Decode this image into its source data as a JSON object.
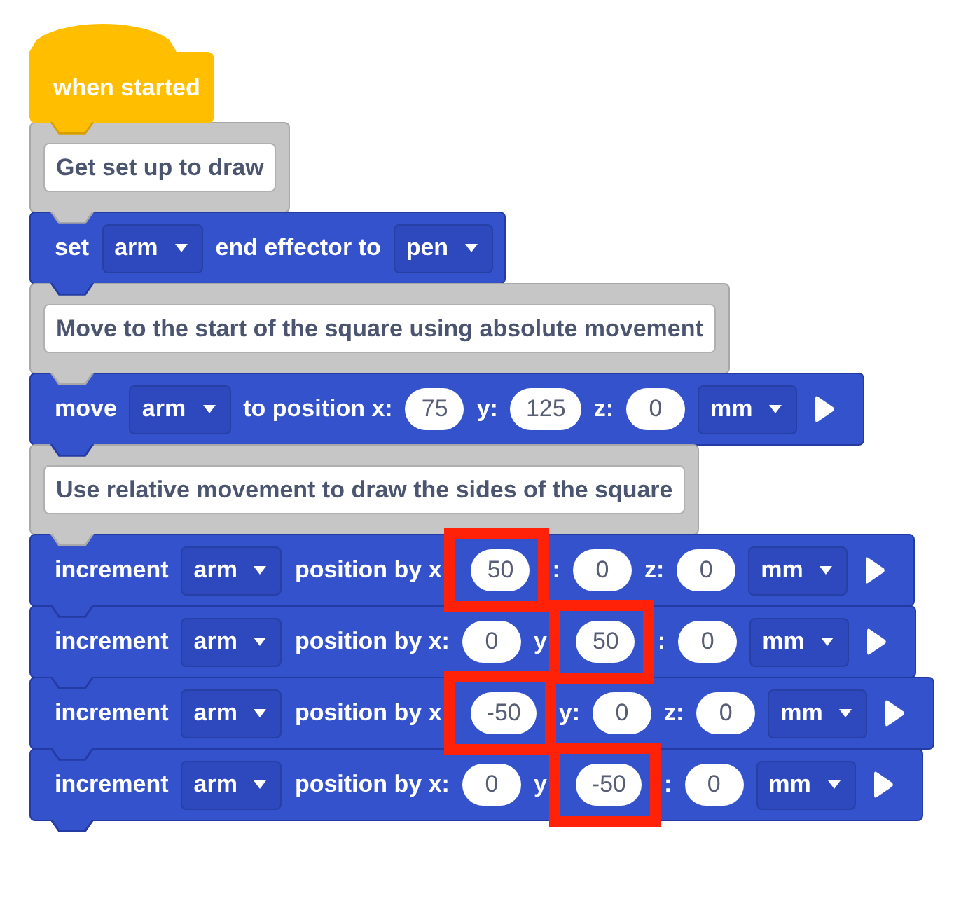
{
  "blocks": [
    {
      "kind": "hat",
      "text": "when started"
    },
    {
      "kind": "comment",
      "text": "Get set up to draw"
    },
    {
      "kind": "command",
      "parts": [
        {
          "kind": "label",
          "text": "set"
        },
        {
          "kind": "dropdown",
          "text": "arm"
        },
        {
          "kind": "label",
          "text": "end effector to"
        },
        {
          "kind": "dropdown",
          "text": "pen"
        }
      ]
    },
    {
      "kind": "comment",
      "text": "Move to the start of the square using absolute movement"
    },
    {
      "kind": "command",
      "parts": [
        {
          "kind": "label",
          "text": "move"
        },
        {
          "kind": "dropdown",
          "text": "arm"
        },
        {
          "kind": "label",
          "text": "to position x:"
        },
        {
          "kind": "number",
          "text": "75",
          "highlighted": false
        },
        {
          "kind": "label",
          "text": "y:"
        },
        {
          "kind": "number",
          "text": "125",
          "highlighted": false
        },
        {
          "kind": "label",
          "text": "z:"
        },
        {
          "kind": "number",
          "text": "0",
          "highlighted": false
        },
        {
          "kind": "dropdown",
          "text": "mm"
        },
        {
          "kind": "run"
        }
      ]
    },
    {
      "kind": "comment",
      "text": "Use relative movement to draw the sides of the square"
    },
    {
      "kind": "command",
      "parts": [
        {
          "kind": "label",
          "text": "increment"
        },
        {
          "kind": "dropdown",
          "text": "arm"
        },
        {
          "kind": "label",
          "text": "position by x"
        },
        {
          "kind": "number",
          "text": "50",
          "highlighted": true
        },
        {
          "kind": "label",
          "text": ":"
        },
        {
          "kind": "number",
          "text": "0",
          "highlighted": false
        },
        {
          "kind": "label",
          "text": "z:"
        },
        {
          "kind": "number",
          "text": "0",
          "highlighted": false
        },
        {
          "kind": "dropdown",
          "text": "mm"
        },
        {
          "kind": "run"
        }
      ]
    },
    {
      "kind": "command",
      "parts": [
        {
          "kind": "label",
          "text": "increment"
        },
        {
          "kind": "dropdown",
          "text": "arm"
        },
        {
          "kind": "label",
          "text": "position by x:"
        },
        {
          "kind": "number",
          "text": "0",
          "highlighted": false
        },
        {
          "kind": "label",
          "text": "y"
        },
        {
          "kind": "number",
          "text": "50",
          "highlighted": true
        },
        {
          "kind": "label",
          "text": ":"
        },
        {
          "kind": "number",
          "text": "0",
          "highlighted": false
        },
        {
          "kind": "dropdown",
          "text": "mm"
        },
        {
          "kind": "run"
        }
      ]
    },
    {
      "kind": "command",
      "parts": [
        {
          "kind": "label",
          "text": "increment"
        },
        {
          "kind": "dropdown",
          "text": "arm"
        },
        {
          "kind": "label",
          "text": "position by x"
        },
        {
          "kind": "number",
          "text": "-50",
          "highlighted": true
        },
        {
          "kind": "label",
          "text": "y:"
        },
        {
          "kind": "number",
          "text": "0",
          "highlighted": false
        },
        {
          "kind": "label",
          "text": "z:"
        },
        {
          "kind": "number",
          "text": "0",
          "highlighted": false
        },
        {
          "kind": "dropdown",
          "text": "mm"
        },
        {
          "kind": "run"
        }
      ]
    },
    {
      "kind": "command",
      "parts": [
        {
          "kind": "label",
          "text": "increment"
        },
        {
          "kind": "dropdown",
          "text": "arm"
        },
        {
          "kind": "label",
          "text": "position by x:"
        },
        {
          "kind": "number",
          "text": "0",
          "highlighted": false
        },
        {
          "kind": "label",
          "text": "y"
        },
        {
          "kind": "number",
          "text": "-50",
          "highlighted": true
        },
        {
          "kind": "label",
          "text": ":"
        },
        {
          "kind": "number",
          "text": "0",
          "highlighted": false
        },
        {
          "kind": "dropdown",
          "text": "mm"
        },
        {
          "kind": "run"
        }
      ]
    }
  ]
}
